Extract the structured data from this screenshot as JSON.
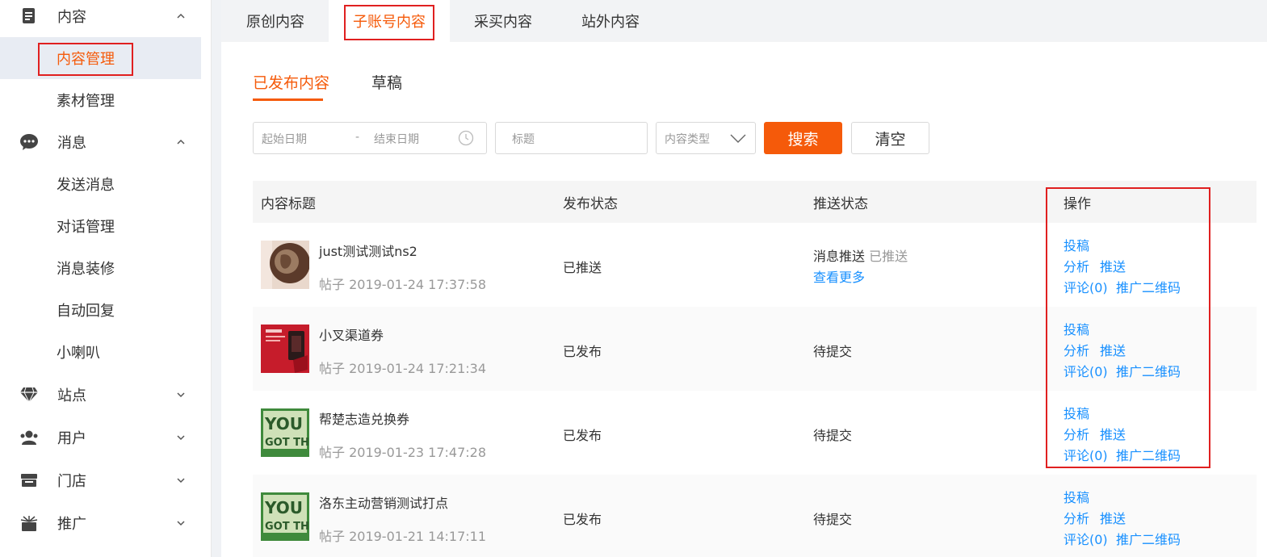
{
  "sidebar": {
    "groups": [
      {
        "label": "内容",
        "icon": "document-icon",
        "expanded": true
      },
      {
        "label": "消息",
        "icon": "chat-bubble-icon",
        "expanded": true
      },
      {
        "label": "站点",
        "icon": "diamond-icon",
        "expanded": false
      },
      {
        "label": "用户",
        "icon": "users-icon",
        "expanded": false
      },
      {
        "label": "门店",
        "icon": "store-icon",
        "expanded": false
      },
      {
        "label": "推广",
        "icon": "promotion-icon",
        "expanded": false
      }
    ],
    "content_items": [
      "内容管理",
      "素材管理"
    ],
    "message_items": [
      "发送消息",
      "对话管理",
      "消息装修",
      "自动回复",
      "小喇叭"
    ],
    "active_item": "内容管理"
  },
  "tabs": [
    "原创内容",
    "子账号内容",
    "采买内容",
    "站外内容"
  ],
  "active_tab": "子账号内容",
  "subtabs": [
    "已发布内容",
    "草稿"
  ],
  "active_subtab": "已发布内容",
  "filters": {
    "start_date_placeholder": "起始日期",
    "date_separator": "-",
    "end_date_placeholder": "结束日期",
    "title_placeholder": "标题",
    "type_placeholder": "内容类型",
    "search_label": "搜索",
    "clear_label": "清空"
  },
  "table": {
    "headers": [
      "内容标题",
      "发布状态",
      "推送状态",
      "操作"
    ],
    "rows": [
      {
        "title": "just测试测试ns2",
        "meta": "帖子 2019-01-24 17:37:58",
        "publish_status": "已推送",
        "push_type": "消息推送",
        "push_state": "已推送",
        "more": "查看更多",
        "thumb": "coffee-image"
      },
      {
        "title": "小叉渠道券",
        "meta": "帖子 2019-01-24 17:21:34",
        "publish_status": "已发布",
        "push_status": "待提交",
        "thumb": "red-coupon-image"
      },
      {
        "title": "帮楚志造兑换券",
        "meta": "帖子 2019-01-23 17:47:28",
        "publish_status": "已发布",
        "push_status": "待提交",
        "thumb": "you-got-this-image"
      },
      {
        "title": "洛东主动营销测试打点",
        "meta": "帖子 2019-01-21 14:17:11",
        "publish_status": "已发布",
        "push_status": "待提交",
        "thumb": "you-got-this-image"
      }
    ],
    "actions": {
      "submit": "投稿",
      "analyze": "分析",
      "push": "推送",
      "comment": "评论(0)",
      "qrcode": "推广二维码"
    }
  },
  "colors": {
    "accent": "#f55a0a",
    "link": "#1890ff",
    "highlight_box": "#e02020"
  }
}
